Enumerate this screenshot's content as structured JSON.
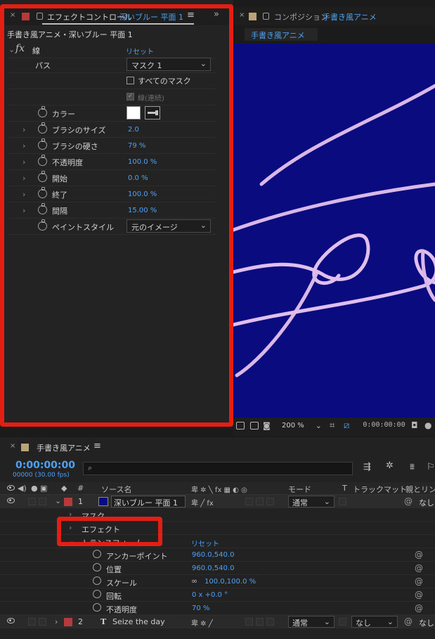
{
  "effect_controls": {
    "tab_title": "エフェクトコントロール",
    "tab_layer": "深いブルー 平面 1",
    "subtitle": "手書き風アニメ・深いブルー 平面 1",
    "effect_name": "線",
    "reset": "リセット",
    "path_label": "パス",
    "path_value": "マスク 1",
    "all_masks": "すべてのマスク",
    "stroke_sequential": "線(連続)",
    "color_label": "カラー",
    "properties": [
      {
        "label": "ブラシのサイズ",
        "value": "2.0"
      },
      {
        "label": "ブラシの硬さ",
        "value": "79 %"
      },
      {
        "label": "不透明度",
        "value": "100.0 %"
      },
      {
        "label": "開始",
        "value": "0.0 %"
      },
      {
        "label": "終了",
        "value": "100.0 %"
      },
      {
        "label": "間隔",
        "value": "15.00 %"
      }
    ],
    "paint_style_label": "ペイントスタイル",
    "paint_style_value": "元のイメージ"
  },
  "composition": {
    "tab_prefix": "コンポジション",
    "tab_name": "手書き風アニメ",
    "subtab": "手書き風アニメ",
    "zoom": "200 %",
    "timecode": "0:00:00:00",
    "background_color": "#0b0b80",
    "stroke_color": "#d9b8e8"
  },
  "timeline": {
    "tab_name": "手書き風アニメ",
    "timecode": "0:00:00:00",
    "fps": "00000 (30.00 fps)",
    "headers": {
      "num": "#",
      "source": "ソース名",
      "mode": "モード",
      "t": "T",
      "trackmatte": "トラックマット",
      "parent": "親とリンク"
    },
    "layer1": {
      "num": "1",
      "name": "深いブルー 平面 1",
      "mode": "通常",
      "parent": "なし"
    },
    "mask_label": "マスク",
    "effect_label": "エフェクト",
    "transform_label": "トランスフォーム",
    "transform_reset": "リセット",
    "transform": [
      {
        "label": "アンカーポイント",
        "value": "960.0,540.0"
      },
      {
        "label": "位置",
        "value": "960.0,540.0"
      },
      {
        "label": "スケール",
        "value": "100.0,100.0 %"
      },
      {
        "label": "回転",
        "value": "0 x +0.0 °"
      },
      {
        "label": "不透明度",
        "value": "70 %"
      }
    ],
    "layer2": {
      "num": "2",
      "type": "T",
      "name": "Seize the day",
      "mode": "通常",
      "trackmatte": "なし",
      "parent": "なし"
    }
  }
}
